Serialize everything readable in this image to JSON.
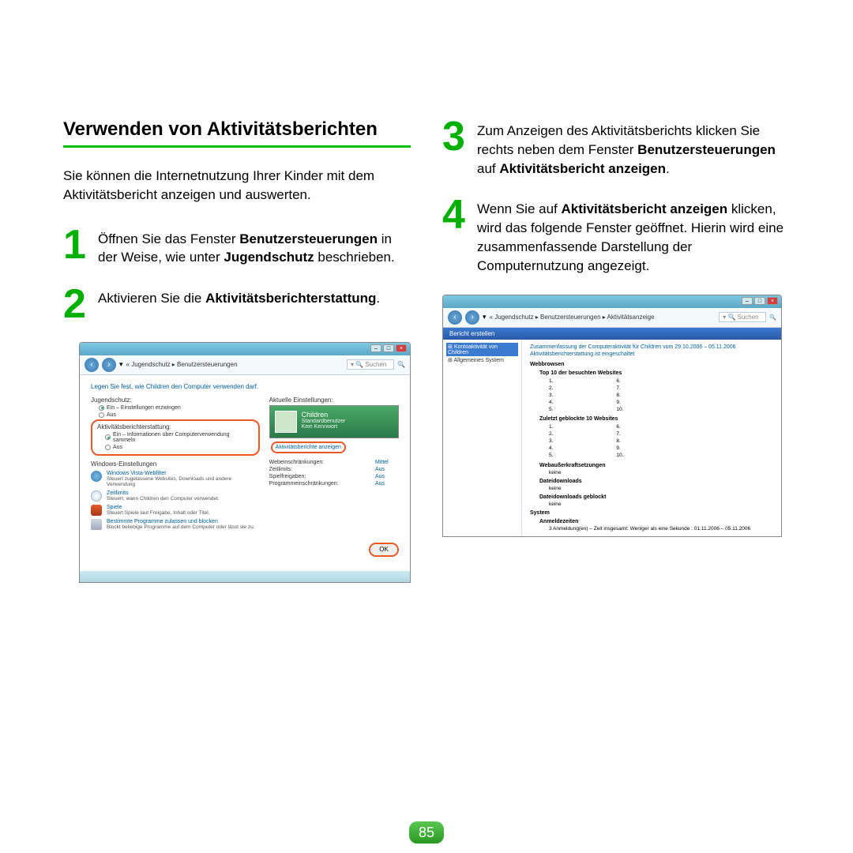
{
  "page_number": "85",
  "left": {
    "title": "Verwenden von Aktivitätsberichten",
    "intro": "Sie können die Internetnutzung Ihrer Kinder mit dem Aktivitätsbericht anzeigen und auswerten.",
    "step1": {
      "num": "1",
      "a": "Öffnen Sie das Fenster ",
      "b": "Benutzersteuerungen",
      "c": " in der Weise, wie unter ",
      "d": "Jugendschutz",
      "e": " beschrieben."
    },
    "step2": {
      "num": "2",
      "a": "Aktivieren Sie die ",
      "b": "Aktivitätsberichterstattung",
      "c": "."
    }
  },
  "right": {
    "step3": {
      "num": "3",
      "a": "Zum Anzeigen des Aktivitätsberichts klicken Sie rechts neben dem Fenster ",
      "b": "Benutzersteuerungen",
      "c": " auf ",
      "d": "Aktivitätsbericht anzeigen",
      "e": "."
    },
    "step4": {
      "num": "4",
      "a": "Wenn Sie auf ",
      "b": "Aktivitätsbericht anzeigen",
      "c": " klicken, wird das folgende Fenster geöffnet. Hierin wird eine zusammenfassende Darstellung der Computernutzung angezeigt."
    }
  },
  "shot1": {
    "breadcrumb": "« Jugendschutz ▸ Benutzersteuerungen",
    "search": "Suchen",
    "instruction": "Legen Sie fest, wie Children den Computer verwenden darf.",
    "jugend_label": "Jugendschutz:",
    "jugend_on": "Ein – Einstellungen erzwingen",
    "jugend_off": "Aus",
    "akt_label": "Aktivitätsberichterstattung:",
    "akt_on": "Ein – Informationen über Computerverwendung sammeln",
    "akt_off": "Aus",
    "win_label": "Windows-Einstellungen",
    "w1t": "Windows Vista-Webfilter",
    "w1s": "Steuert zugelassene Websites, Downloads und andere Verwendung",
    "w2t": "Zeitlimits",
    "w2s": "Steuert, wann Children den Computer verwendet.",
    "w3t": "Spiele",
    "w3s": "Steuert Spiele laut Freigabe, Inhalt oder Titel.",
    "w4t": "Bestimmte Programme zulassen und blocken",
    "w4s": "Blockt beliebige Programme auf dem Computer oder lässt sie zu.",
    "r_label": "Aktuelle Einstellungen:",
    "user": "Children",
    "user_sub1": "Standardbenutzer",
    "user_sub2": "Kein Kennwort",
    "link": "Aktivitätsberichte anzeigen",
    "c1l": "Webeinschränkungen:",
    "c1v": "Mittel",
    "c2l": "Zeitlimits:",
    "c2v": "Aus",
    "c3l": "Spielfreigaben:",
    "c3v": "Aus",
    "c4l": "Programmeinschränkungen:",
    "c4v": "Aus",
    "ok": "OK"
  },
  "shot2": {
    "breadcrumb": "« Jugendschutz ▸ Benutzersteuerungen ▸ Aktivitätsanzeige",
    "search": "Suchen",
    "menu": "Bericht erstellen",
    "tree_sel": "Kontoaktivität von Children",
    "tree_it": "Allgemeines System",
    "head": "Zusammenfassung der Computeraktivität für Children vom 29.10.2006 – 05.11.2006",
    "sub": "Aktivitätsberichterstattung ist eingeschaltet",
    "s_web": "Webbrowsen",
    "s_top": "Top 10 der besuchten Websites",
    "s_block": "Zuletzt geblockte 10 Websites",
    "s_over": "Webaußerkraftsetzungen",
    "none": "keine",
    "s_dl": "Dateidownloads",
    "s_dlb": "Dateidownloads geblockt",
    "s_sys": "System",
    "s_login": "Anmeldezeiten",
    "login_note": "3 Anmeldung(en) – Zeit insgesamt: Weniger als eine Sekunde : 01.11.2006 – 05.11.2006",
    "n1": "1.",
    "n2": "2.",
    "n3": "3.",
    "n4": "4.",
    "n5": "5.",
    "n6": "6.",
    "n7": "7.",
    "n8": "8.",
    "n9": "9.",
    "n10": "10."
  }
}
